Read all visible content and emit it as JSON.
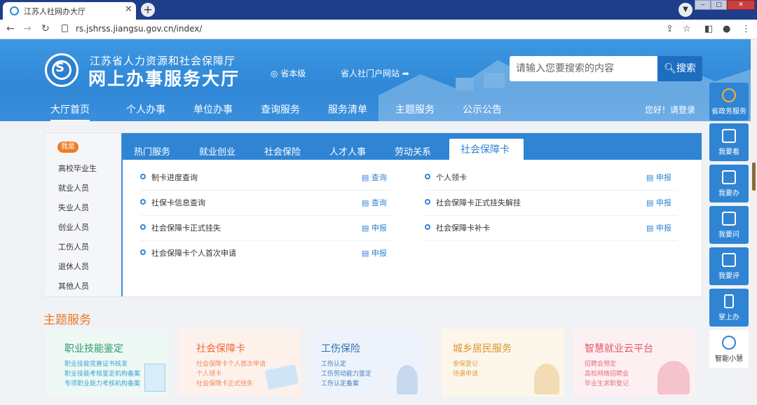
{
  "browser": {
    "tab_title": "江苏人社网办大厅",
    "tab_close": "✕",
    "new_tab": "+",
    "url": "rs.jshrss.jiangsu.gov.cn/index/"
  },
  "header": {
    "org": "江苏省人力资源和社会保障厅",
    "hall": "网上办事服务大厅",
    "location": "省本级",
    "portal": "省人社门户网站",
    "search_placeholder": "请输入您要搜索的内容",
    "search_button": "搜索",
    "greeting": "您好！请登录",
    "nav": [
      "大厅首页",
      "个人办事",
      "单位办事",
      "查询服务",
      "服务清单",
      "主题服务",
      "公示公告"
    ]
  },
  "side": [
    "省政务服务",
    "我要看",
    "我要办",
    "我要问",
    "我要评",
    "掌上办",
    "智能小慧"
  ],
  "left_panel": {
    "badge": "我是",
    "items": [
      "高校毕业生",
      "就业人员",
      "失业人员",
      "创业人员",
      "工伤人员",
      "退休人员",
      "其他人员"
    ]
  },
  "tabs": [
    "热门服务",
    "就业创业",
    "社会保险",
    "人才人事",
    "劳动关系",
    "社会保障卡"
  ],
  "services": [
    {
      "name": "制卡进度查询",
      "action": "查询"
    },
    {
      "name": "个人领卡",
      "action": "申报"
    },
    {
      "name": "社保卡信息查询",
      "action": "查询"
    },
    {
      "name": "社会保障卡正式挂失解挂",
      "action": "申报"
    },
    {
      "name": "社会保障卡正式挂失",
      "action": "申报"
    },
    {
      "name": "社会保障卡补卡",
      "action": "申报"
    },
    {
      "name": "社会保障卡个人首次申请",
      "action": "申报"
    }
  ],
  "theme": {
    "heading": "主题服务",
    "cards": [
      {
        "title": "职业技能鉴定",
        "lines": [
          "职业技能竞赛证书核发",
          "职业技能考核鉴定机构备案",
          "专项职业能力考核机构备案"
        ],
        "bg": "#eef8f4",
        "color": "#2a9a6a",
        "sub": "#3aa6d8"
      },
      {
        "title": "社会保障卡",
        "lines": [
          "社会保障卡个人首次申请",
          "个人领卡",
          "社会保障卡正式挂失"
        ],
        "bg": "#fdf1ec",
        "color": "#ef6a3a",
        "sub": "#ef8a5a"
      },
      {
        "title": "工伤保险",
        "lines": [
          "工伤认定",
          "工伤劳动能力鉴定",
          "工伤认定备案"
        ],
        "bg": "#eef3fb",
        "color": "#2d6fb8",
        "sub": "#4a7fc2"
      },
      {
        "title": "城乡居民服务",
        "lines": [
          "参保登记",
          "待遇申请"
        ],
        "bg": "#fdf6ea",
        "color": "#d9962a",
        "sub": "#e0a040"
      },
      {
        "title": "智慧就业云平台",
        "lines": [
          "招聘会预定",
          "高校网络招聘会",
          "毕业生求职登记"
        ],
        "bg": "#fdf0f2",
        "color": "#e4566a",
        "sub": "#e8707e"
      }
    ]
  }
}
